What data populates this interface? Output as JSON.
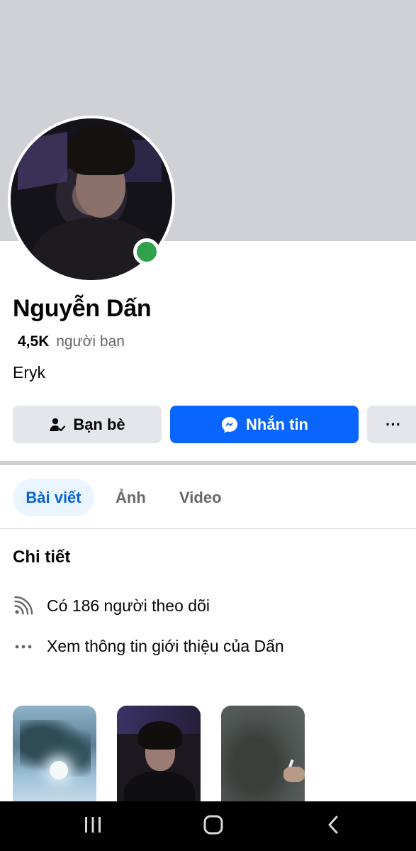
{
  "profile": {
    "name": "Nguyễn Dấn",
    "friends_count": "4,5K",
    "friends_label": "người bạn",
    "bio": "Eryk",
    "online": true
  },
  "actions": {
    "friends_label": "Bạn bè",
    "message_label": "Nhắn tin",
    "more_label": "···"
  },
  "tabs": [
    {
      "label": "Bài viết",
      "active": true
    },
    {
      "label": "Ảnh",
      "active": false
    },
    {
      "label": "Video",
      "active": false
    }
  ],
  "details": {
    "title": "Chi tiết",
    "followers": "Có 186 người theo dõi",
    "about_link": "Xem thông tin giới thiệu của Dấn"
  },
  "colors": {
    "accent": "#0866ff",
    "online": "#31a24c",
    "cover": "#cfd1d6",
    "tab_active_bg": "#ebf5ff",
    "tab_active_text": "#0864d6"
  },
  "icons": {
    "friends": "friend-check-icon",
    "message": "messenger-icon",
    "more": "more-icon",
    "followers": "rss-icon",
    "about": "more-dots-icon",
    "nav_recent": "recent-apps-icon",
    "nav_home": "home-icon",
    "nav_back": "back-icon"
  }
}
